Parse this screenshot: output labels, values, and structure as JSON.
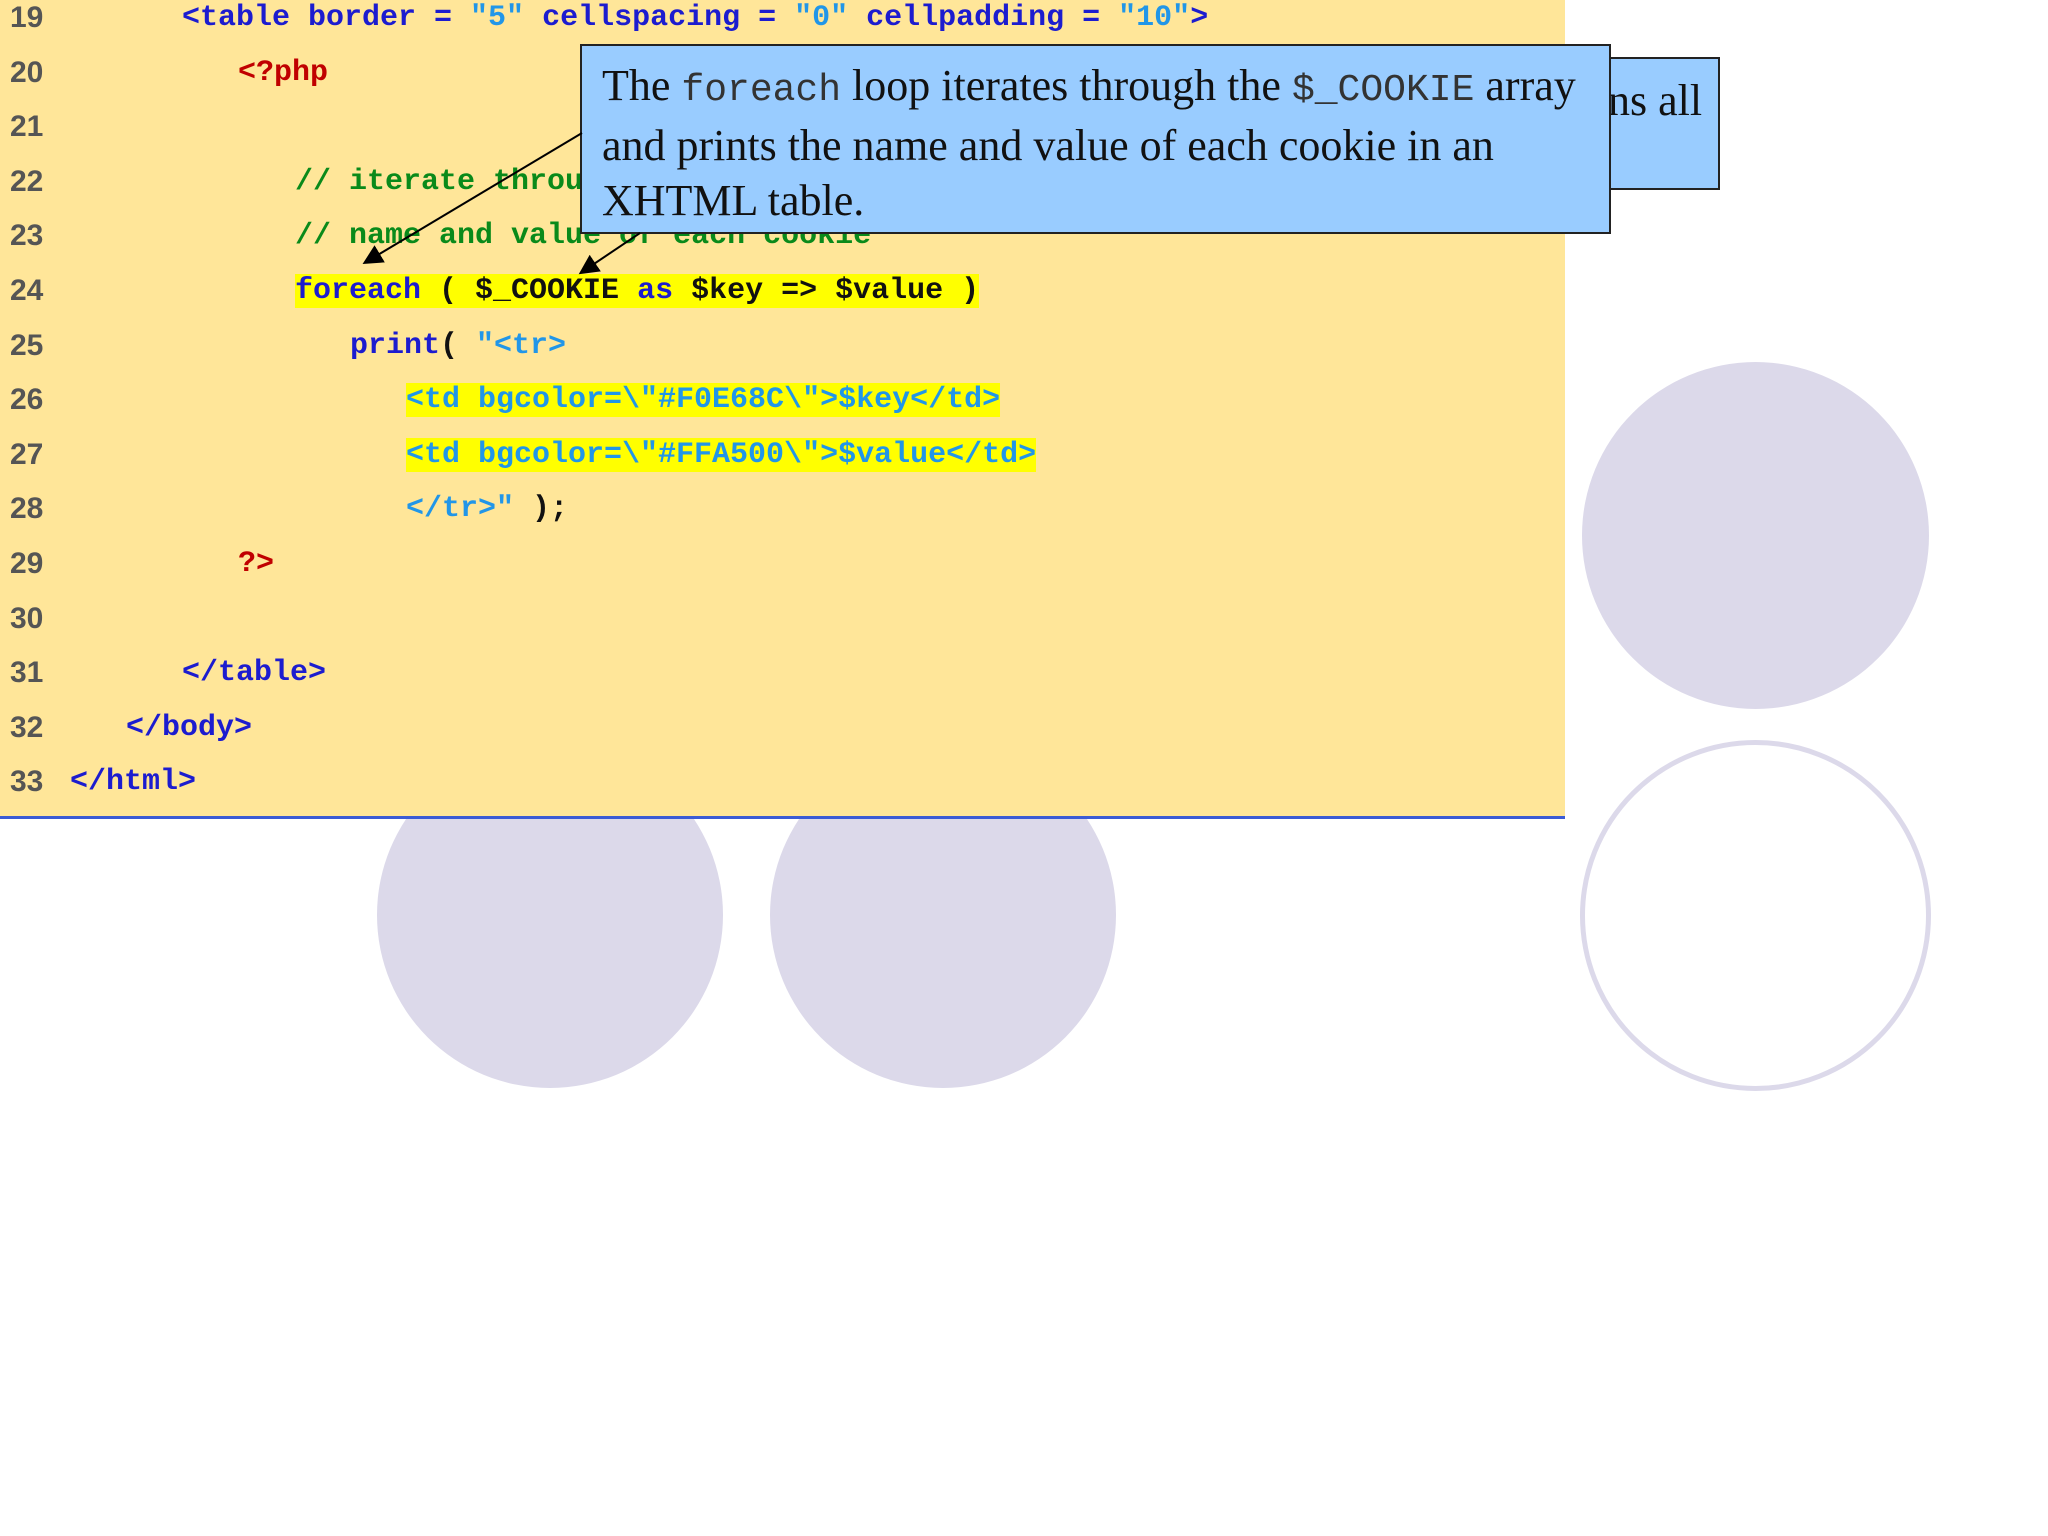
{
  "code_lines": [
    {
      "num": "19",
      "parts": [
        {
          "t": "<table border = ",
          "c": "tag"
        },
        {
          "t": "\"5\"",
          "c": "str"
        },
        {
          "t": " cellspacing = ",
          "c": "tag"
        },
        {
          "t": "\"0\"",
          "c": "str"
        },
        {
          "t": " cellpadding = ",
          "c": "tag"
        },
        {
          "t": "\"10\"",
          "c": "str"
        },
        {
          "t": ">",
          "c": "tag"
        }
      ]
    },
    {
      "num": "20",
      "parts": [
        {
          "t": "<?php",
          "c": "php"
        }
      ]
    },
    {
      "num": "21",
      "parts": []
    },
    {
      "num": "22",
      "parts": [
        {
          "t": "// iterate throu",
          "c": "cmt"
        }
      ]
    },
    {
      "num": "23",
      "parts": [
        {
          "t": "// name and value of each cookie",
          "c": "cmt"
        }
      ]
    },
    {
      "num": "24",
      "parts": [
        {
          "t": "foreach",
          "c": "tag hl"
        },
        {
          "t": " ( $_COOKIE ",
          "c": "dark hl"
        },
        {
          "t": "as",
          "c": "tag hl"
        },
        {
          "t": " $key => $value )",
          "c": "dark hl"
        }
      ]
    },
    {
      "num": "25",
      "parts": [
        {
          "t": "print",
          "c": "tag"
        },
        {
          "t": "( ",
          "c": "dark"
        },
        {
          "t": "\"<tr>",
          "c": "str"
        }
      ]
    },
    {
      "num": "26",
      "parts": [
        {
          "t": "<td bgcolor=\\\"#F0E68C\\\">$key</td>",
          "c": "str hl"
        }
      ]
    },
    {
      "num": "27",
      "parts": [
        {
          "t": "<td bgcolor=\\\"#FFA500\\\">$value</td>",
          "c": "str hl"
        }
      ]
    },
    {
      "num": "28",
      "parts": [
        {
          "t": "</tr>\"",
          "c": "str"
        },
        {
          "t": " );",
          "c": "dark"
        }
      ]
    },
    {
      "num": "29",
      "parts": [
        {
          "t": "?>",
          "c": "php"
        }
      ]
    },
    {
      "num": "30",
      "parts": []
    },
    {
      "num": "31",
      "parts": [
        {
          "t": "</table>",
          "c": "tag"
        }
      ]
    },
    {
      "num": "32",
      "parts": [
        {
          "t": "</body>",
          "c": "tag"
        }
      ]
    },
    {
      "num": "33",
      "parts": [
        {
          "t": "</html>",
          "c": "tag"
        }
      ]
    }
  ],
  "callout_main": {
    "text1": "The ",
    "code1": "foreach",
    "text2": " loop iterates through the ",
    "code2": "$_COOKIE",
    "text3": " array and prints the name and value of each cookie in an XHTML table."
  },
  "callout_behind": {
    "text": "ns all"
  },
  "colors": {
    "panel": "#ffe699",
    "callout": "#99ccff",
    "circle": "#dcd9ea",
    "highlight": "#ffff00"
  }
}
